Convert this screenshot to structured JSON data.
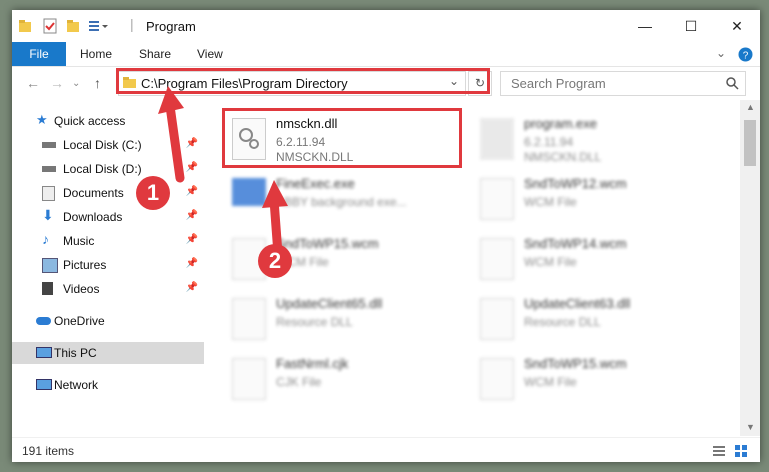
{
  "window": {
    "title": "Program"
  },
  "ribbon": {
    "tabs": [
      "File",
      "Home",
      "Share",
      "View"
    ]
  },
  "address": {
    "path": "C:\\Program Files\\Program Directory"
  },
  "search": {
    "placeholder": "Search Program"
  },
  "sidebar": {
    "items": [
      {
        "label": "Quick access"
      },
      {
        "label": "Local Disk (C:)"
      },
      {
        "label": "Local Disk (D:)"
      },
      {
        "label": "Documents"
      },
      {
        "label": "Downloads"
      },
      {
        "label": "Music"
      },
      {
        "label": "Pictures"
      },
      {
        "label": "Videos"
      },
      {
        "label": "OneDrive"
      },
      {
        "label": "This PC"
      },
      {
        "label": "Network"
      }
    ]
  },
  "files": [
    {
      "name": "nmsckn.dll",
      "sub1": "6.2.11.94",
      "sub2": "NMSCKN.DLL"
    },
    {
      "name": "program.exe",
      "sub1": "6.2.11.94",
      "sub2": "NMSCKN.DLL"
    },
    {
      "name": "FineExec.exe",
      "sub1": "ABBY background exe...",
      "sub2": ""
    },
    {
      "name": "SndToWP12.wcm",
      "sub1": "WCM File",
      "sub2": ""
    },
    {
      "name": "SndToWP15.wcm",
      "sub1": "WCM File",
      "sub2": ""
    },
    {
      "name": "SndToWP14.wcm",
      "sub1": "WCM File",
      "sub2": ""
    },
    {
      "name": "UpdateClient65.dll",
      "sub1": "Resource DLL",
      "sub2": ""
    },
    {
      "name": "UpdateClient63.dll",
      "sub1": "Resource DLL",
      "sub2": ""
    },
    {
      "name": "FastNrml.cjk",
      "sub1": "CJK File",
      "sub2": ""
    },
    {
      "name": "SndToWP15.wcm",
      "sub1": "WCM File",
      "sub2": ""
    }
  ],
  "status": {
    "count": "191 items"
  },
  "annotations": {
    "badge1": "1",
    "badge2": "2"
  },
  "colors": {
    "accent": "#1979ca",
    "highlight": "#e0393e"
  }
}
